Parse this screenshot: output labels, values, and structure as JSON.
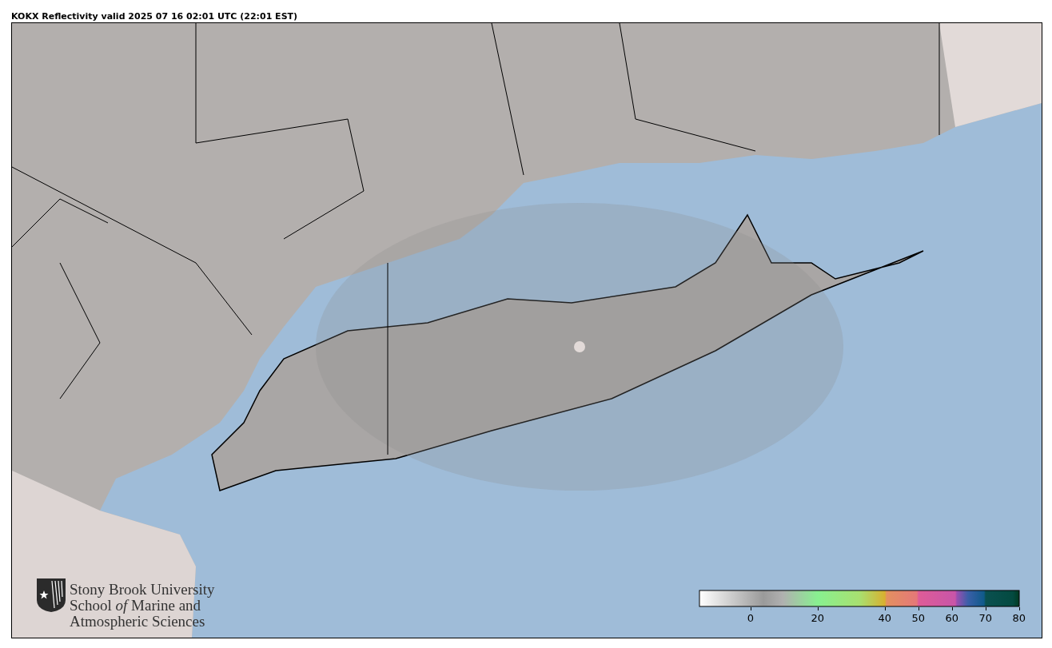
{
  "title": "KOKX Reflectivity valid 2025 07 16 02:01 UTC (22:01 EST)",
  "logo": {
    "lines": [
      "Stony Brook University",
      "School *of* Marine and",
      "Atmospheric Sciences"
    ]
  },
  "colorbar": {
    "ticks": [
      "0",
      "20",
      "40",
      "50",
      "60",
      "70",
      "80"
    ]
  }
}
